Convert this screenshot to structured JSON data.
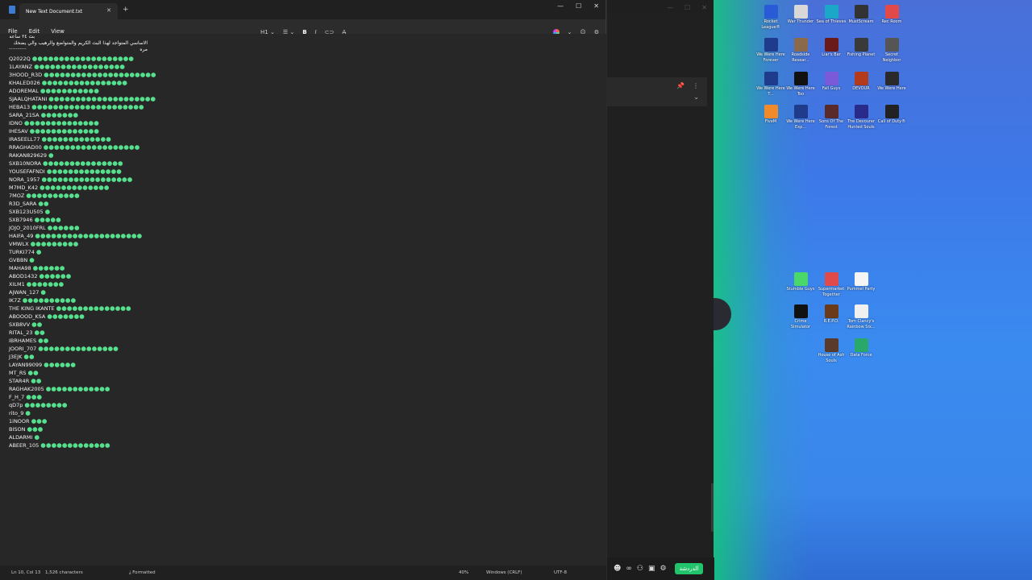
{
  "notepad": {
    "tab_title": "New Text Document.txt",
    "menus": [
      "File",
      "Edit",
      "View"
    ],
    "heading_selector": "H1",
    "format_bold": "B",
    "format_italic": "I",
    "header_line1": "بث ٢٤ ساعه",
    "header_line2": "الاساسي المتواجد لهذا البث الكريم والمتواضع والرهيب والي يضحك مره",
    "separator": "----------",
    "entries": [
      {
        "name": "Q2022Q",
        "dots": 19
      },
      {
        "name": "1LAYANZ",
        "dots": 17
      },
      {
        "name": "3HOOD_R3D",
        "dots": 21
      },
      {
        "name": "KHALED026",
        "dots": 16
      },
      {
        "name": "ADOREMAL",
        "dots": 11
      },
      {
        "name": "SJAALQHATANI",
        "dots": 20
      },
      {
        "name": "HEBA13",
        "dots": 21
      },
      {
        "name": "SARA_21SA",
        "dots": 7
      },
      {
        "name": "IDNO",
        "dots": 14
      },
      {
        "name": "IHESAV",
        "dots": 13
      },
      {
        "name": "IRASEELL77",
        "dots": 13
      },
      {
        "name": "RRAGHAD00",
        "dots": 18
      },
      {
        "name": "RAKAN829629",
        "dots": 1
      },
      {
        "name": "SXB10NORA",
        "dots": 15
      },
      {
        "name": "YOUSEFAFNDI",
        "dots": 14
      },
      {
        "name": "NORA_1957",
        "dots": 17
      },
      {
        "name": "M7MD_K42",
        "dots": 13
      },
      {
        "name": "7MOZ",
        "dots": 10
      },
      {
        "name": "R3D_SARA",
        "dots": 2
      },
      {
        "name": "SXB123U505",
        "dots": 1
      },
      {
        "name": "SXB7946",
        "dots": 5
      },
      {
        "name": "JOJO_2010FRL",
        "dots": 6
      },
      {
        "name": "HAIFA_49",
        "dots": 20
      },
      {
        "name": "VMWLX",
        "dots": 9
      },
      {
        "name": "TURKI774",
        "dots": 1
      },
      {
        "name": "GVBBN",
        "dots": 1
      },
      {
        "name": "MAHA98",
        "dots": 6
      },
      {
        "name": "ABOD1432",
        "dots": 6
      },
      {
        "name": "XILM1",
        "dots": 7
      },
      {
        "name": "AJWAN_127",
        "dots": 1
      },
      {
        "name": "IK7Z",
        "dots": 10
      },
      {
        "name": "THE KING IKANTE",
        "dots": 14
      },
      {
        "name": "ABOOOD_KSA",
        "dots": 7
      },
      {
        "name": "SXB8VV",
        "dots": 2
      },
      {
        "name": "RITAL_23",
        "dots": 2
      },
      {
        "name": "IBRHAMES",
        "dots": 2
      },
      {
        "name": "JOORI_707",
        "dots": 15
      },
      {
        "name": "J3EJK",
        "dots": 2
      },
      {
        "name": "LAYAN99099",
        "dots": 6
      },
      {
        "name": "MT_RS",
        "dots": 2
      },
      {
        "name": "STAR4R",
        "dots": 2
      },
      {
        "name": "RAGHAK2005",
        "dots": 12
      },
      {
        "name": "F_H_7",
        "dots": 3
      },
      {
        "name": "qD7p",
        "dots": 8
      },
      {
        "name": "rito_9",
        "dots": 1
      },
      {
        "name": "1iNOOR",
        "dots": 3
      },
      {
        "name": "BISON",
        "dots": 3
      },
      {
        "name": "ALDARMI",
        "dots": 1
      },
      {
        "name": "ABEER_105",
        "dots": 13
      }
    ],
    "status": {
      "position": "Ln 10, Col 13",
      "characters": "1,526 characters",
      "format": "Formatted",
      "zoom": "40%",
      "line_endings": "Windows (CRLF)",
      "encoding": "UTF-8"
    }
  },
  "side_window": {
    "action_button": "الدردشة"
  },
  "desktop_icons": [
    {
      "label": "Rocket League®",
      "color": "#2a5bd7"
    },
    {
      "label": "War Thunder",
      "color": "#d8d8d8"
    },
    {
      "label": "Sea of Thieves",
      "color": "#1aa7c8"
    },
    {
      "label": "MustScream",
      "color": "#333333"
    },
    {
      "label": "Rec Room",
      "color": "#e24a4a"
    },
    {
      "label": "We Were Here Forever",
      "color": "#1e3b8c"
    },
    {
      "label": "Roadside Resear...",
      "color": "#8a6a4a"
    },
    {
      "label": "Liar's Bar",
      "color": "#6b1a1a"
    },
    {
      "label": "Fishing Planet",
      "color": "#3a3a3a"
    },
    {
      "label": "Secret Neighbor",
      "color": "#555555"
    },
    {
      "label": "We Were Here T...",
      "color": "#1e3b8c"
    },
    {
      "label": "We Were Here Too",
      "color": "#111111"
    },
    {
      "label": "Fall Guys",
      "color": "#7a5ad8"
    },
    {
      "label": "DEVOUR",
      "color": "#b33a1a"
    },
    {
      "label": "We Were Here",
      "color": "#2a2a2a"
    },
    {
      "label": "FiveM",
      "color": "#f08a2a"
    },
    {
      "label": "We Were Here Exp...",
      "color": "#1e3b8c"
    },
    {
      "label": "Sons Of The Forest",
      "color": "#5a2a2a"
    },
    {
      "label": "The Devourer Hunted Souls",
      "color": "#2a2a8a"
    },
    {
      "label": "Call of Duty®",
      "color": "#222222"
    },
    {
      "label": "Stumble Guys",
      "color": "#4ad86a"
    },
    {
      "label": "Supermarket Together",
      "color": "#e04a4a"
    },
    {
      "label": "Pummel Party",
      "color": "#f5f5f5"
    },
    {
      "label": "Crime Simulator",
      "color": "#111111"
    },
    {
      "label": "R.E.P.O.",
      "color": "#6a3a1a"
    },
    {
      "label": "Tom Clancy's Rainbow Six...",
      "color": "#f0f0f0"
    },
    {
      "label": "House of Ash Souls",
      "color": "#5a3a2a"
    },
    {
      "label": "Data Force",
      "color": "#2aa86a"
    }
  ]
}
